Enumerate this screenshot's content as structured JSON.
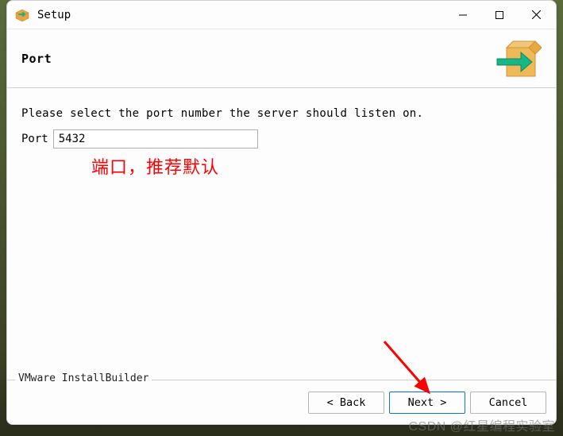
{
  "titlebar": {
    "title": "Setup"
  },
  "header": {
    "title": "Port"
  },
  "content": {
    "instruction": "Please select the port number the server should listen on.",
    "port_label": "Port",
    "port_value": "5432"
  },
  "annotation": {
    "text": "端口，推荐默认"
  },
  "footer": {
    "builder": "VMware InstallBuilder",
    "back": "< Back",
    "next": "Next >",
    "cancel": "Cancel"
  },
  "watermark": "CSDN @红星编程实验室"
}
